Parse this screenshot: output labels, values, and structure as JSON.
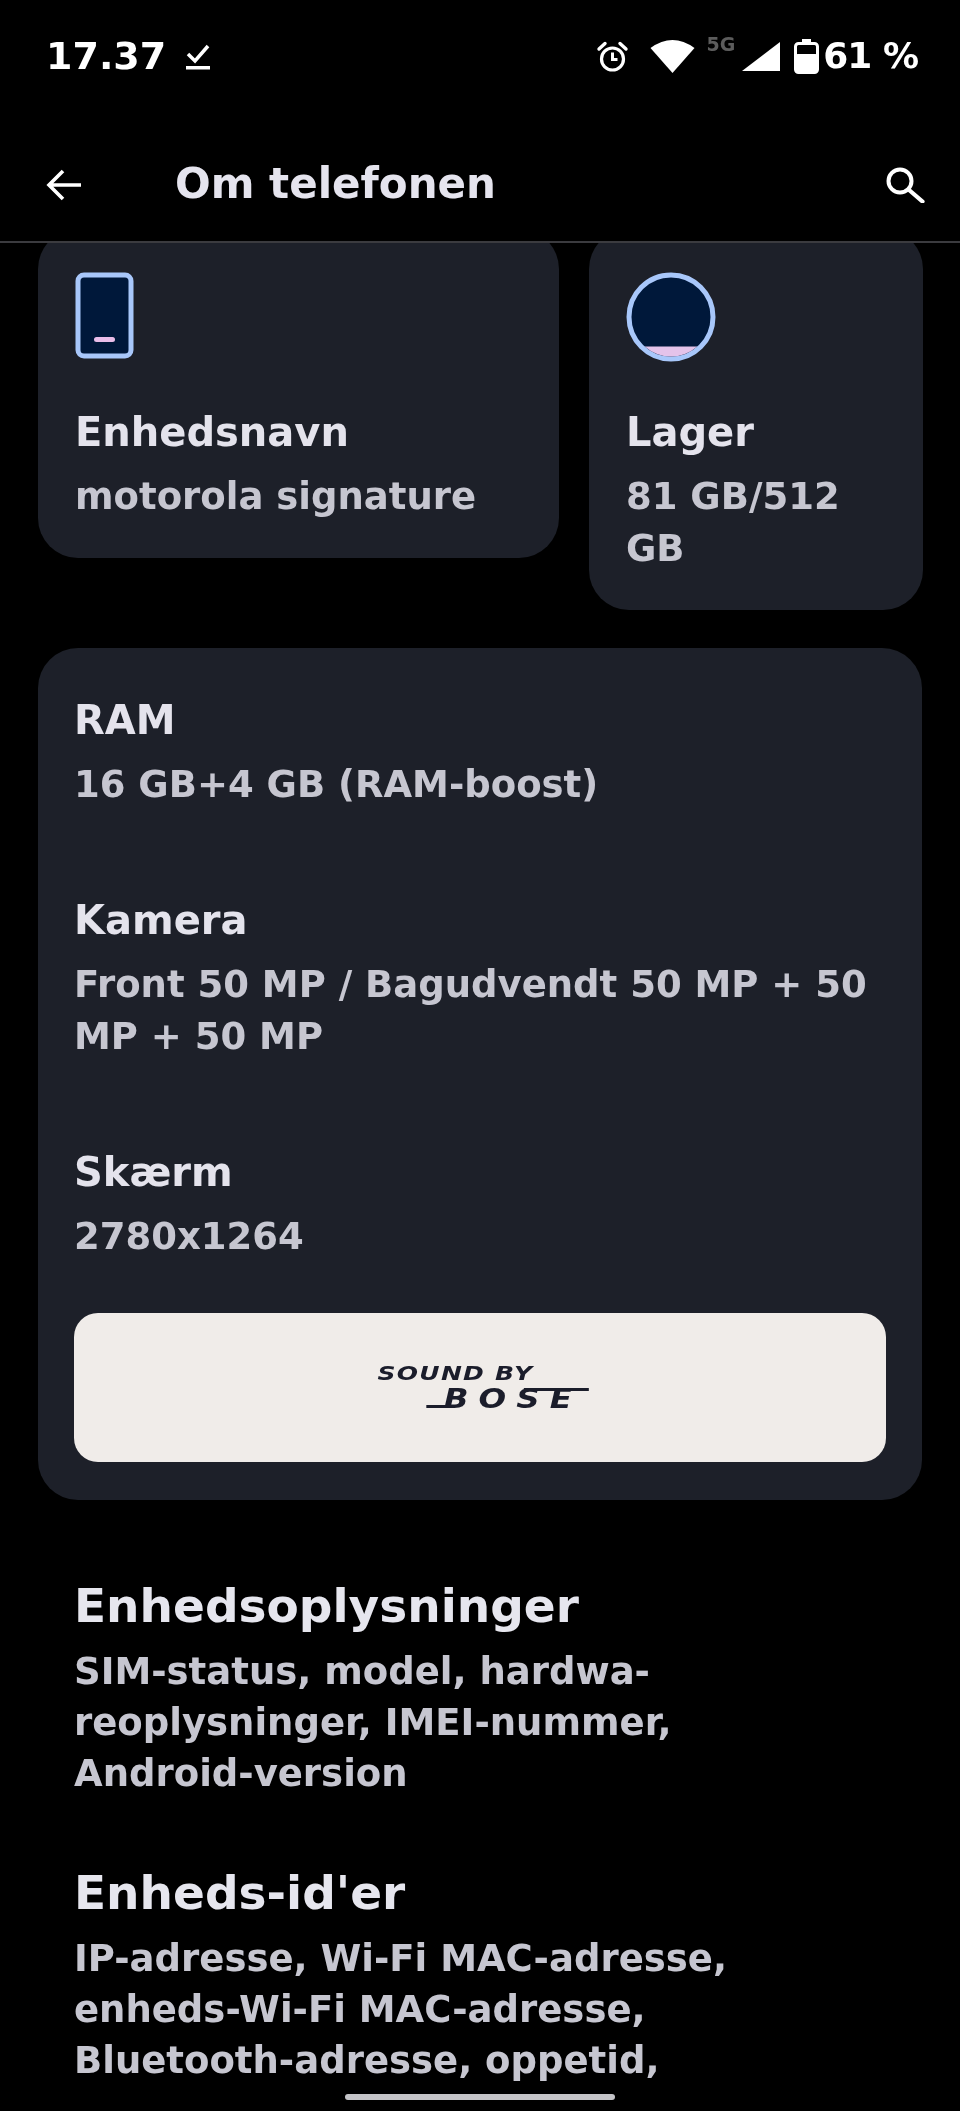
{
  "status_bar": {
    "time": "17.37",
    "network": "5G",
    "battery": "61 %"
  },
  "app_bar": {
    "title": "Om telefonen"
  },
  "tiles": [
    {
      "kind": "device",
      "label": "Enhedsnavn",
      "value": "motorola signature"
    },
    {
      "kind": "storage",
      "label": "Lager",
      "value": "81 GB/512 GB"
    }
  ],
  "specs": [
    {
      "label": "RAM",
      "value": "16 GB+4 GB (RAM-boost)"
    },
    {
      "label": "Kamera",
      "value": "Front 50 MP / Bagudvendt 50 MP + 50 MP + 50 MP"
    },
    {
      "label": "Skærm",
      "value": "2780x1264"
    }
  ],
  "audio_banner": {
    "line_1": "SOUND BY",
    "line_2": "BOSE"
  },
  "settings": [
    {
      "title": "Enhedsoplysninger",
      "summary": "SIM-status, model, hardwa-reoplysninger, IMEI-nummer, Android-version"
    },
    {
      "title": "Enheds-id'er",
      "summary": "IP-adresse, Wi-Fi MAC-adresse, enheds-Wi-Fi MAC-adresse, Bluetooth-adresse, oppetid,"
    }
  ]
}
